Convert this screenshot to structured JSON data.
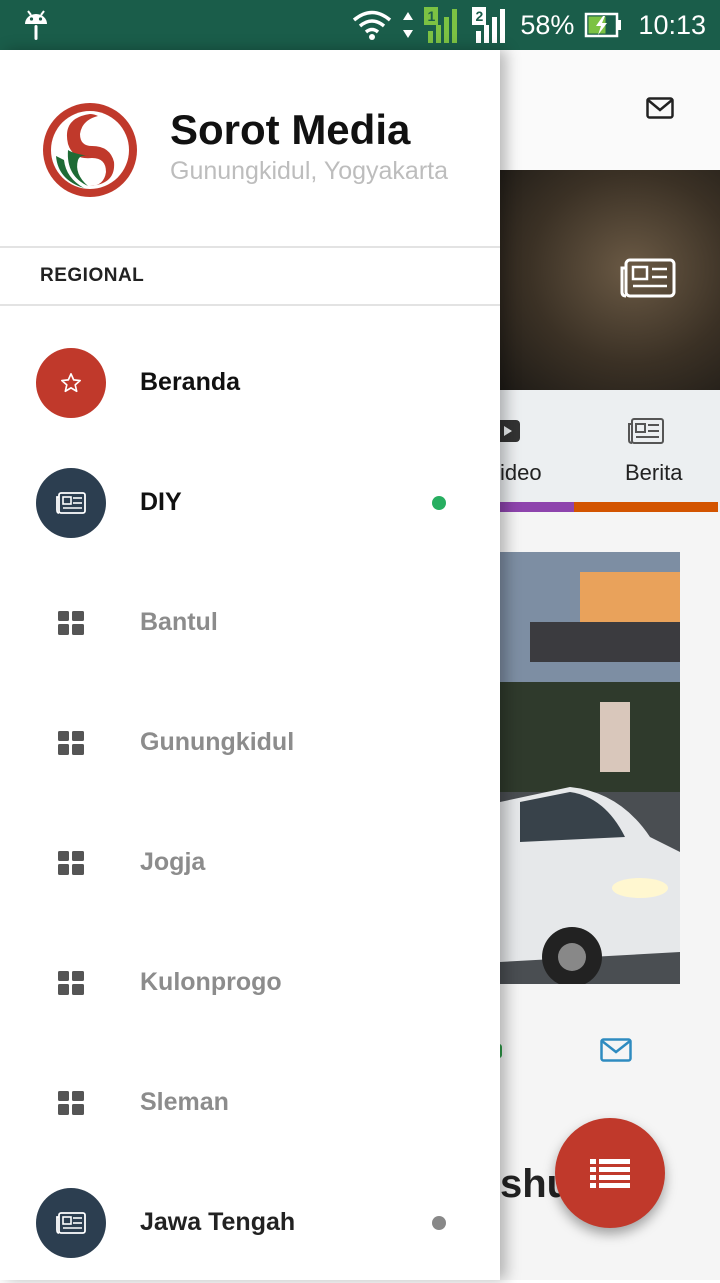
{
  "status_bar": {
    "battery": "58%",
    "time": "10:13",
    "sim1_label": "1",
    "sim2_label": "2"
  },
  "drawer": {
    "title": "Sorot Media",
    "subtitle": "Gunungkidul, Yogyakarta",
    "section_label": "REGIONAL",
    "items": [
      {
        "label": "Beranda",
        "icon": "star-icon",
        "circle_color": "#c0392b",
        "dot": null
      },
      {
        "label": "DIY",
        "icon": "newspaper-icon",
        "circle_color": "#2c3e50",
        "dot": "#27ae60"
      },
      {
        "label": "Bantul",
        "icon": "grid-icon"
      },
      {
        "label": "Gunungkidul",
        "icon": "grid-icon"
      },
      {
        "label": "Jogja",
        "icon": "grid-icon"
      },
      {
        "label": "Kulonprogo",
        "icon": "grid-icon"
      },
      {
        "label": "Sleman",
        "icon": "grid-icon"
      },
      {
        "label": "Jawa Tengah",
        "icon": "newspaper-icon",
        "circle_color": "#2c3e50",
        "dot": "#888888"
      }
    ]
  },
  "background_app": {
    "tabs": [
      {
        "label": "ideo",
        "icon": "play-icon",
        "indicator_color": "#8e44ad"
      },
      {
        "label": "Berita",
        "icon": "newspaper-icon",
        "indicator_color": "#d35400"
      }
    ],
    "partial_headline": "shu",
    "fab_icon": "list-icon",
    "fab_color": "#c0392b"
  },
  "colors": {
    "status_bar": "#1a5d4a",
    "accent_red": "#c0392b",
    "navy": "#2c3e50",
    "active_dot": "#27ae60"
  }
}
